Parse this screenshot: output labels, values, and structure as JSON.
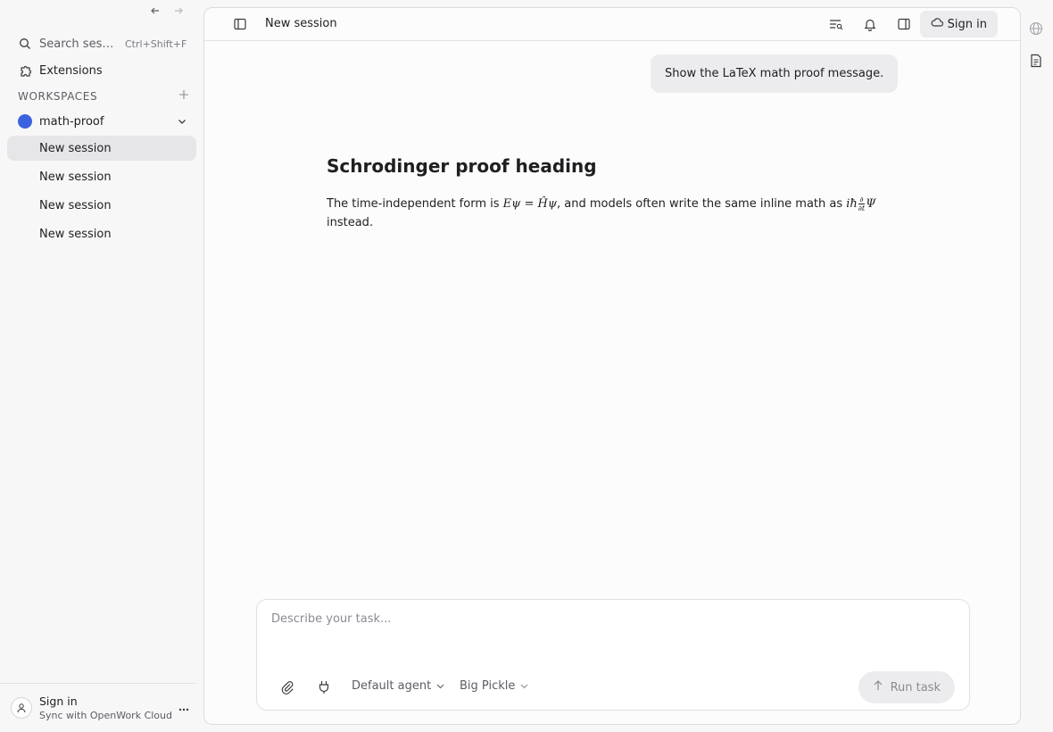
{
  "sidebar": {
    "search": {
      "label": "Search sessions",
      "shortcut": "Ctrl+Shift+F"
    },
    "extensions_label": "Extensions",
    "workspaces_heading": "WORKSPACES",
    "workspace": {
      "name": "math-proof",
      "color": "#3b63e0"
    },
    "sessions": [
      "New session",
      "New session",
      "New session",
      "New session"
    ],
    "footer": {
      "title": "Sign in",
      "subtitle": "Sync with OpenWork Cloud"
    }
  },
  "topbar": {
    "title": "New session",
    "signin_label": "Sign in"
  },
  "chat": {
    "user_message": "Show the LaTeX math proof message.",
    "answer_heading": "Schrodinger proof heading",
    "answer_text_1": "The time-independent form is ",
    "math_1": "Eψ = Ĥψ",
    "answer_text_2": ", and models often write the same inline math as ",
    "math_2a": "iħ",
    "math_2_num": "∂",
    "math_2_den": "∂t",
    "math_2b": "Ψ",
    "answer_text_3": " instead."
  },
  "composer": {
    "placeholder": "Describe your task...",
    "agent_label": "Default agent",
    "model_label": "Big Pickle",
    "run_label": "Run task"
  },
  "icons": {
    "back": "arrow-left-icon",
    "forward": "arrow-right-icon",
    "search": "search-icon",
    "extensions": "puzzle-icon",
    "globe": "globe-icon",
    "document": "document-icon"
  }
}
